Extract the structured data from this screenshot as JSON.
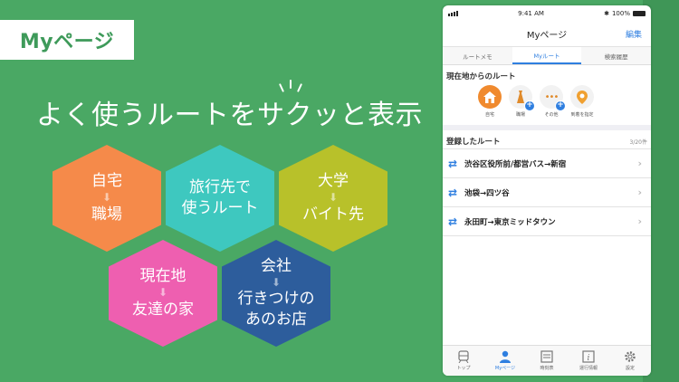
{
  "badge": {
    "label": "Myページ"
  },
  "headline": "よく使うルートをサクッと表示",
  "hexes": [
    {
      "top": "自宅",
      "arrow": "⬇",
      "bottom": "職場",
      "color": "#f58a4a"
    },
    {
      "top": "旅行先で",
      "bottom": "使うルート",
      "color": "#3ec8bf"
    },
    {
      "top": "大学",
      "arrow": "⬇",
      "bottom": "バイト先",
      "color": "#b8c12a"
    },
    {
      "top": "現在地",
      "arrow": "⬇",
      "bottom": "友達の家",
      "color": "#ee5fb0"
    },
    {
      "top": "会社",
      "arrow": "⬇",
      "bottom": "行きつけの\nあのお店",
      "color": "#2d5d9c"
    }
  ],
  "phone": {
    "status": {
      "time": "9:41 AM",
      "battery": "100%"
    },
    "title": "Myページ",
    "edit": "編集",
    "tabs": [
      "ルートメモ",
      "Myルート",
      "検索履歴"
    ],
    "current_section": "現在地からのルート",
    "quick": [
      "自宅",
      "職場",
      "その他",
      "到着を指定"
    ],
    "registered_section": "登録したルート",
    "registered_count": "3/20件",
    "routes": [
      "渋谷区役所前/都営バス→新宿",
      "池袋→四ツ谷",
      "永田町→東京ミッドタウン"
    ],
    "tabbar": [
      "トップ",
      "Myページ",
      "時刻表",
      "運行情報",
      "設定"
    ]
  }
}
